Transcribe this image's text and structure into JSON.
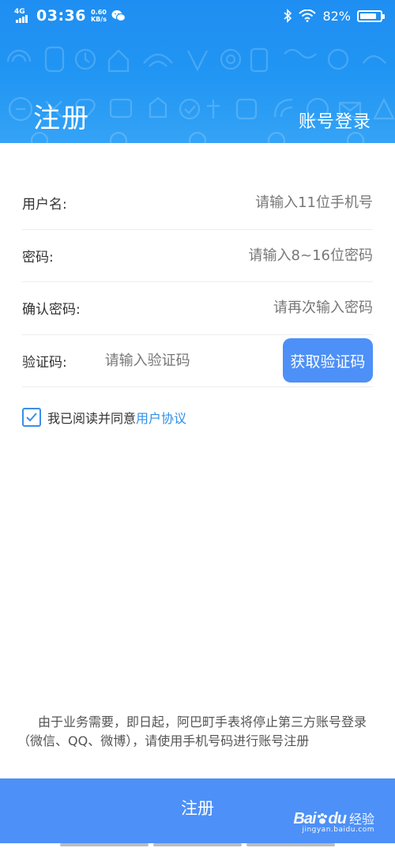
{
  "statusbar": {
    "network": "4G",
    "time": "03:36",
    "speed_value": "0.60",
    "speed_unit": "KB/s",
    "battery": "82%",
    "battery_level": 0.82
  },
  "header": {
    "title": "注册",
    "account_login": "账号登录"
  },
  "form": {
    "username_label": "用户名:",
    "username_placeholder": "请输入11位手机号",
    "password_label": "密码:",
    "password_placeholder": "请输入8~16位密码",
    "confirm_label": "确认密码:",
    "confirm_placeholder": "请再次输入密码",
    "code_label": "验证码:",
    "code_placeholder": "请输入验证码",
    "get_code_button": "获取验证码"
  },
  "agreement": {
    "checked": true,
    "text": "我已阅读并同意",
    "link": "用户协议"
  },
  "notice": "由于业务需要，即日起，阿巴町手表将停止第三方账号登录（微信、QQ、微博），请使用手机号码进行账号注册",
  "submit_label": "注册",
  "watermark": {
    "logo": "Bai",
    "logo_suffix": "du",
    "text": "经验",
    "url": "jingyan.baidu.com"
  }
}
